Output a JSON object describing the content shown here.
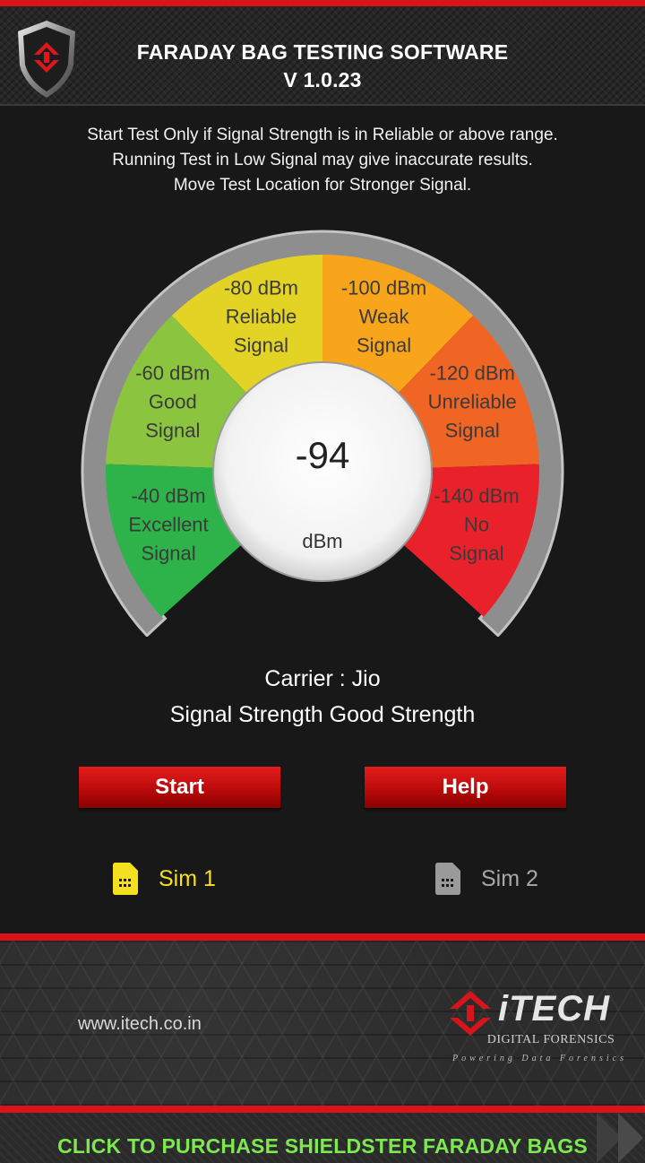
{
  "header": {
    "title": "FARADAY BAG TESTING SOFTWARE",
    "version": "V 1.0.23"
  },
  "notice": {
    "line1": "Start Test Only if Signal Strength is in Reliable or above range.",
    "line2": "Running Test in Low Signal may give inaccurate results.",
    "line3": "Move Test Location for Stronger Signal."
  },
  "gauge": {
    "value": "-94",
    "unit": "dBm",
    "segments": [
      {
        "level": "-40 dBm",
        "line2": "Excellent",
        "line3": "Signal",
        "color": "#2db34a"
      },
      {
        "level": "-60 dBm",
        "line2": "Good",
        "line3": "Signal",
        "color": "#8bc540"
      },
      {
        "level": "-80 dBm",
        "line2": "Reliable",
        "line3": "Signal",
        "color": "#e3d325"
      },
      {
        "level": "-100 dBm",
        "line2": "Weak",
        "line3": "Signal",
        "color": "#f9a51b"
      },
      {
        "level": "-120 dBm",
        "line2": "Unreliable",
        "line3": "Signal",
        "color": "#f06424"
      },
      {
        "level": "-140 dBm",
        "line2": "No",
        "line3": "Signal",
        "color": "#e9212b"
      }
    ]
  },
  "status": {
    "carrier": "Carrier : Jio",
    "signal": "Signal Strength  Good Strength"
  },
  "buttons": {
    "start": "Start",
    "help": "Help"
  },
  "sims": {
    "sim1": {
      "label": "Sim 1",
      "color": "#f5e01f",
      "icon": "sim-card-icon"
    },
    "sim2": {
      "label": "Sim 2",
      "color": "#9a9a9a",
      "icon": "sim-card-icon"
    }
  },
  "footer": {
    "website": "www.itech.co.in",
    "brand": "iTECH",
    "brand_sub": "DIGITAL FORENSICS",
    "brand_tag": "Powering Data Forensics"
  },
  "banner": {
    "text": "CLICK TO PURCHASE SHIELDSTER FARADAY BAGS"
  },
  "colors": {
    "accent_red": "#d8141a",
    "banner_green": "#7de84f"
  }
}
